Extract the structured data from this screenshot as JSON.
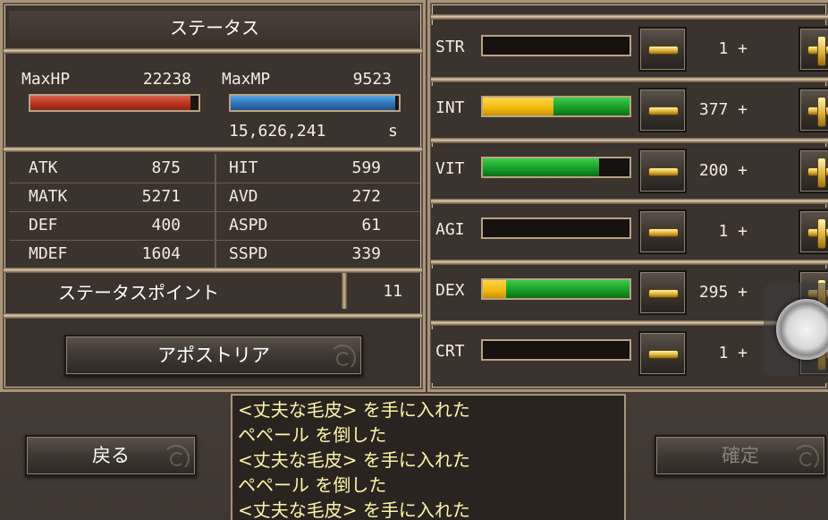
{
  "title": "ステータス",
  "hp": {
    "label": "MaxHP",
    "value": "22238",
    "fill": 0.95
  },
  "mp": {
    "label": "MaxMP",
    "value": "9523",
    "fill": 0.98
  },
  "exp": {
    "value": "15,626,241",
    "unit": "s"
  },
  "stats": [
    {
      "l1": "ATK",
      "v1": "875",
      "l2": "HIT",
      "v2": "599"
    },
    {
      "l1": "MATK",
      "v1": "5271",
      "l2": "AVD",
      "v2": "272"
    },
    {
      "l1": "DEF",
      "v1": "400",
      "l2": "ASPD",
      "v2": "61"
    },
    {
      "l1": "MDEF",
      "v1": "1604",
      "l2": "SSPD",
      "v2": "339"
    }
  ],
  "status_points": {
    "label": "ステータスポイント",
    "value": "11"
  },
  "class_button": "アポストリア",
  "back_button": "戻る",
  "confirm_button": "確定",
  "attributes": [
    {
      "name": "STR",
      "value": "1 +",
      "yellow": 0.0,
      "green": 0.0
    },
    {
      "name": "INT",
      "value": "377 +",
      "yellow": 0.48,
      "green": 0.52
    },
    {
      "name": "VIT",
      "value": "200 +",
      "yellow": 0.0,
      "green": 0.79
    },
    {
      "name": "AGI",
      "value": "1 +",
      "yellow": 0.0,
      "green": 0.0
    },
    {
      "name": "DEX",
      "value": "295 +",
      "yellow": 0.16,
      "green": 0.84
    },
    {
      "name": "CRT",
      "value": "1 +",
      "yellow": 0.0,
      "green": 0.0
    }
  ],
  "log": [
    "<丈夫な毛皮> を手に入れた",
    "ペペール を倒した",
    "<丈夫な毛皮> を手に入れた",
    "ペペール を倒した",
    "<丈夫な毛皮> を手に入れた"
  ]
}
